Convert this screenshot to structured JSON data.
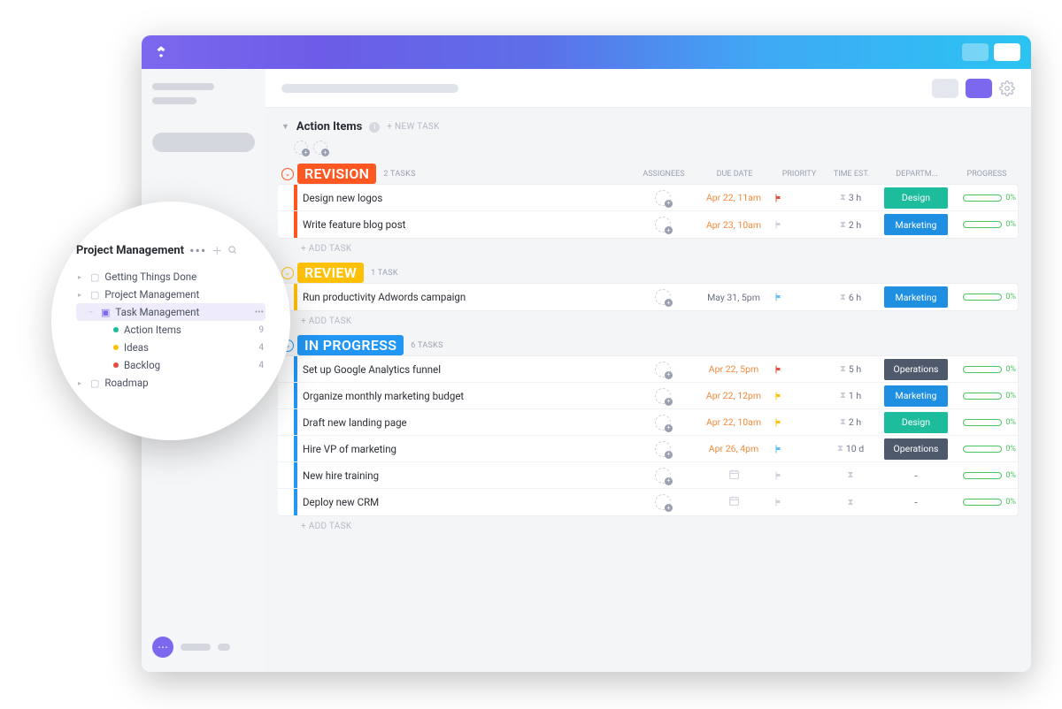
{
  "section": {
    "title": "Action Items",
    "new_task": "+ NEW TASK"
  },
  "columns": {
    "task": "",
    "assignees": "ASSIGNEES",
    "due": "DUE DATE",
    "priority": "PRIORITY",
    "time_est": "TIME EST.",
    "department": "DEPARTM...",
    "progress": "PROGRESS"
  },
  "add_task": "+ ADD TASK",
  "groups": [
    {
      "key": "revision",
      "label": "REVISION",
      "count": "2 TASKS",
      "rows": [
        {
          "name": "Design new logos",
          "due": "Apr 22, 11am",
          "due_color": "#f58a3c",
          "flag": "#E74C3C",
          "time": "3 h",
          "dept": "Design",
          "dept_cls": "dept-design",
          "progress": "0%"
        },
        {
          "name": "Write feature blog post",
          "due": "Apr 23, 10am",
          "due_color": "#f58a3c",
          "flag": "#cfd2dc",
          "time": "2 h",
          "dept": "Marketing",
          "dept_cls": "dept-marketing",
          "progress": "0%"
        }
      ]
    },
    {
      "key": "review",
      "label": "REVIEW",
      "count": "1 TASK",
      "rows": [
        {
          "name": "Run productivity Adwords campaign",
          "due": "May 31, 5pm",
          "due_color": "#6a7081",
          "flag": "#5BC0F8",
          "time": "6 h",
          "dept": "Marketing",
          "dept_cls": "dept-marketing",
          "progress": "0%"
        }
      ]
    },
    {
      "key": "progress",
      "label": "IN PROGRESS",
      "count": "6 TASKS",
      "rows": [
        {
          "name": "Set up Google Analytics funnel",
          "due": "Apr 22, 5pm",
          "due_color": "#f58a3c",
          "flag": "#E74C3C",
          "time": "5 h",
          "dept": "Operations",
          "dept_cls": "dept-operations",
          "progress": "0%"
        },
        {
          "name": "Organize monthly marketing budget",
          "due": "Apr 22, 12pm",
          "due_color": "#f58a3c",
          "flag": "#FFC107",
          "time": "1 h",
          "dept": "Marketing",
          "dept_cls": "dept-marketing",
          "progress": "0%"
        },
        {
          "name": "Draft new landing page",
          "due": "Apr 22, 10am",
          "due_color": "#f58a3c",
          "flag": "#FFC107",
          "time": "2 h",
          "dept": "Design",
          "dept_cls": "dept-design",
          "progress": "0%"
        },
        {
          "name": "Hire VP of marketing",
          "due": "Apr 26, 4pm",
          "due_color": "#f58a3c",
          "flag": "#5BC0F8",
          "time": "10 d",
          "dept": "Operations",
          "dept_cls": "dept-operations",
          "progress": "0%"
        },
        {
          "name": "New hire training",
          "due": "",
          "due_color": "",
          "flag": "#cfd2dc",
          "time": "",
          "dept": "-",
          "dept_cls": "",
          "progress": "0%"
        },
        {
          "name": "Deploy new CRM",
          "due": "",
          "due_color": "",
          "flag": "#cfd2dc",
          "time": "",
          "dept": "-",
          "dept_cls": "",
          "progress": "0%"
        }
      ]
    }
  ],
  "bubble": {
    "title": "Project Management",
    "items": [
      {
        "label": "Getting Things Done",
        "type": "folder",
        "count": "",
        "indent": 0
      },
      {
        "label": "Project Management",
        "type": "folder",
        "count": "",
        "indent": 0
      },
      {
        "label": "Task Management",
        "type": "folder-active",
        "count": "•••",
        "indent": 1
      },
      {
        "label": "Action Items",
        "type": "dot-green",
        "count": "9",
        "indent": 2
      },
      {
        "label": "Ideas",
        "type": "dot-yellow",
        "count": "4",
        "indent": 2
      },
      {
        "label": "Backlog",
        "type": "dot-red",
        "count": "4",
        "indent": 2
      },
      {
        "label": "Roadmap",
        "type": "folder",
        "count": "",
        "indent": 0
      }
    ]
  }
}
